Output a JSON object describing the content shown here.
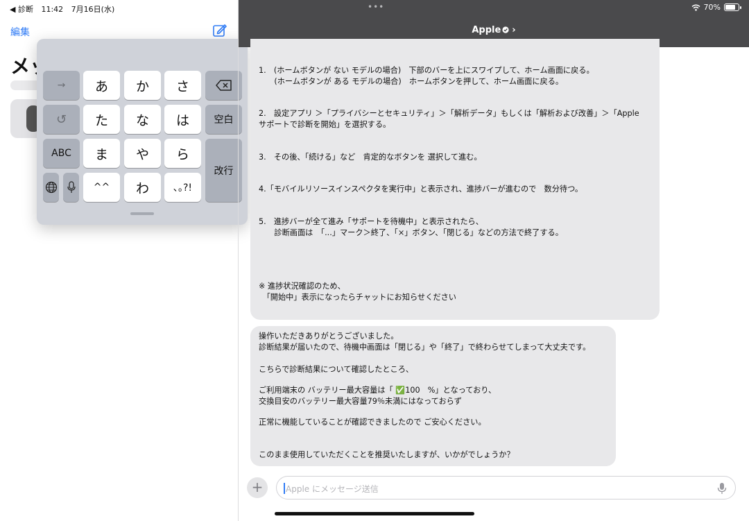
{
  "status_bar": {
    "back_app": "◀ 診断",
    "time": "11:42",
    "date": "7月16日(水)",
    "battery": "70%",
    "battery_level": 0.7
  },
  "left_pane": {
    "edit_label": "編集",
    "title_partial": "メッ"
  },
  "keyboard": {
    "rows": [
      [
        "→",
        "あ",
        "か",
        "さ",
        "⌫"
      ],
      [
        "↺",
        "た",
        "な",
        "は",
        "空白"
      ],
      [
        "ABC",
        "ま",
        "や",
        "ら",
        "改行"
      ],
      [
        "🌐",
        "🎤",
        "^^",
        "わ",
        "､｡?!"
      ]
    ],
    "space_label": "空白",
    "return_label": "改行",
    "abc_label": "ABC",
    "punct_label": "､｡?!"
  },
  "chat": {
    "title": "Apple",
    "bubble1_lines": [
      "1.　(ホームボタンが ない モデルの場合)　下部のバーを上にスワイプして、ホーム画面に戻る。",
      "　　(ホームボタンが ある モデルの場合)　ホームボタンを押して、ホーム画面に戻る。",
      "2.　設定アプリ ＞「プライバシーとセキュリティ」＞「解析データ」もしくは「解析および改善」＞「Apple",
      "サポートで診断を開始」を選択する。",
      "3.　その後、「続ける」など　肯定的なボタンを 選択して進む。",
      "4.「モバイルリソースインスペクタを実行中」と表示され、進捗バーが進むので　数分待つ。",
      "5.　進捗バーが全て進み「サポートを待機中」と表示されたら、",
      "　　診断画面は　「...」マーク＞終了、「×」ボタン、「閉じる」などの方法で終了する。",
      "※ 進捗状況確認のため、",
      "　「開始中」表示になったらチャットにお知らせください"
    ],
    "bubble2_lines": [
      "操作いただきありがとうございました。",
      "診断結果が届いたので、待機中画面は「閉じる」や「終了」で終わらせてしまって大丈夫です。",
      "こちらで診断結果について確認したところ、",
      "ご利用端末の バッテリー最大容量は「 ✅100　%」となっており、",
      "交換目安のバッテリー最大容量79％未満にはなっておらず",
      "正常に機能していることが確認できましたので ご安心ください。",
      "このまま使用していただくことを推奨いたしますが、いかがでしょうか？"
    ],
    "input_placeholder": "Apple にメッセージ送信",
    "add_label": "+"
  }
}
